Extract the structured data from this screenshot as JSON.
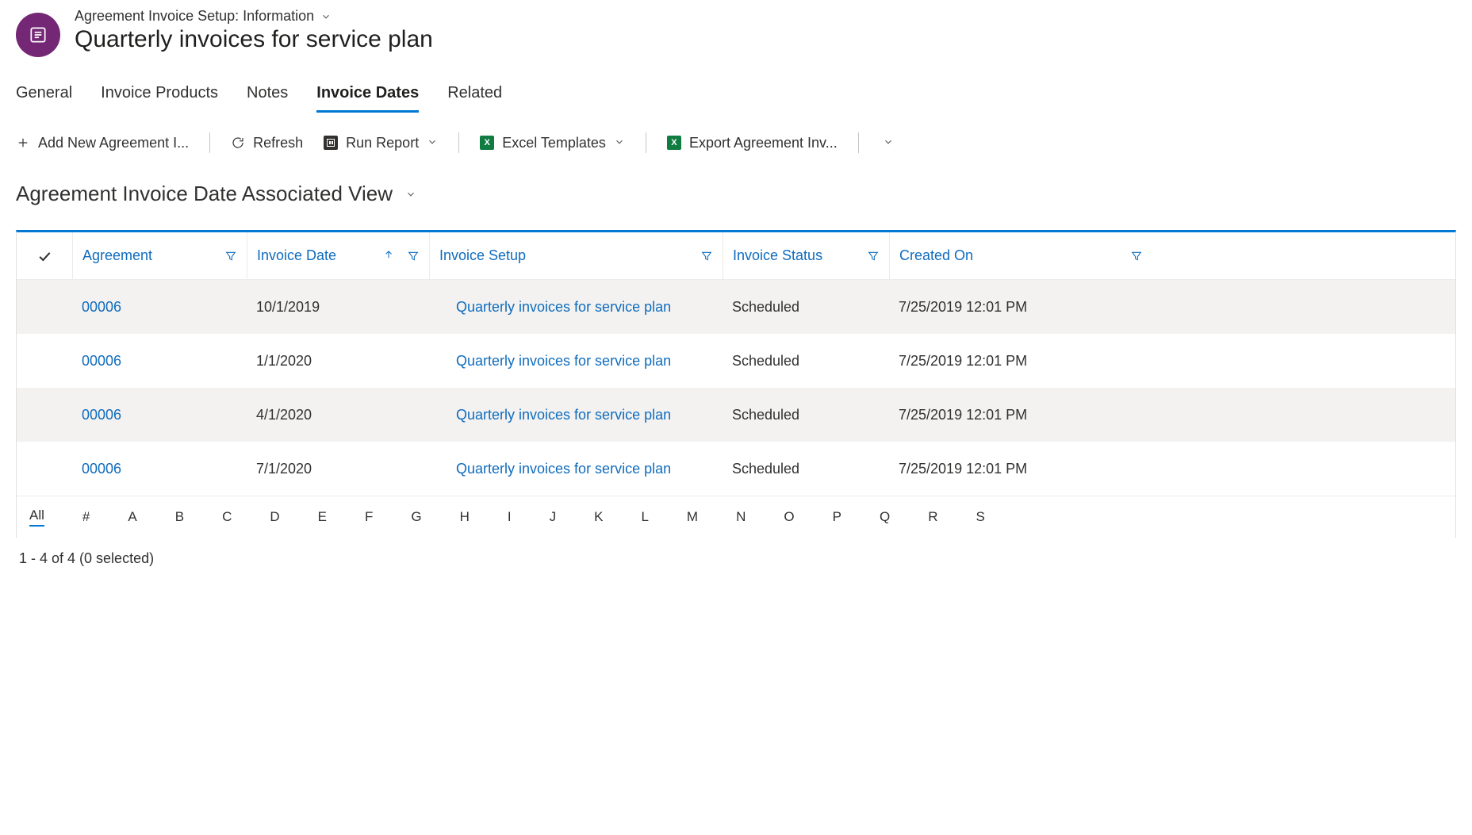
{
  "header": {
    "breadcrumb": "Agreement Invoice Setup: Information",
    "title": "Quarterly invoices for service plan"
  },
  "tabs": [
    {
      "label": "General",
      "active": false
    },
    {
      "label": "Invoice Products",
      "active": false
    },
    {
      "label": "Notes",
      "active": false
    },
    {
      "label": "Invoice Dates",
      "active": true
    },
    {
      "label": "Related",
      "active": false
    }
  ],
  "commands": {
    "add": "Add New Agreement I...",
    "refresh": "Refresh",
    "runReport": "Run Report",
    "excelTemplates": "Excel Templates",
    "export": "Export Agreement Inv..."
  },
  "view": {
    "title": "Agreement Invoice Date Associated View"
  },
  "columns": {
    "agreement": "Agreement",
    "invoiceDate": "Invoice Date",
    "invoiceSetup": "Invoice Setup",
    "invoiceStatus": "Invoice Status",
    "createdOn": "Created On"
  },
  "rows": [
    {
      "agreement": "00006",
      "date": "10/1/2019",
      "setup": "Quarterly invoices for service plan",
      "status": "Scheduled",
      "created": "7/25/2019 12:01 PM"
    },
    {
      "agreement": "00006",
      "date": "1/1/2020",
      "setup": "Quarterly invoices for service plan",
      "status": "Scheduled",
      "created": "7/25/2019 12:01 PM"
    },
    {
      "agreement": "00006",
      "date": "4/1/2020",
      "setup": "Quarterly invoices for service plan",
      "status": "Scheduled",
      "created": "7/25/2019 12:01 PM"
    },
    {
      "agreement": "00006",
      "date": "7/1/2020",
      "setup": "Quarterly invoices for service plan",
      "status": "Scheduled",
      "created": "7/25/2019 12:01 PM"
    }
  ],
  "alpha": [
    "All",
    "#",
    "A",
    "B",
    "C",
    "D",
    "E",
    "F",
    "G",
    "H",
    "I",
    "J",
    "K",
    "L",
    "M",
    "N",
    "O",
    "P",
    "Q",
    "R",
    "S"
  ],
  "alphaSelected": "All",
  "statusLine": "1 - 4 of 4 (0 selected)"
}
